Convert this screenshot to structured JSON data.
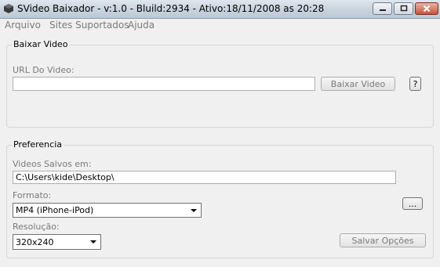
{
  "window": {
    "title": "SVideo Baixador - v:1.0 - Bluild:2934  - Ativo:18/11/2008 as 20:28"
  },
  "menu": [
    "Arquivo",
    "Sites Suportados",
    "Ajuda"
  ],
  "baixar": {
    "group_title": "Baixar Video",
    "url_label": "URL Do Video:",
    "url_value": "",
    "download_button": "Baixar Video",
    "help_button": "?"
  },
  "preferencia": {
    "group_title": "Preferencia",
    "saved_label": "Videos Salvos em:",
    "saved_path": "C:\\Users\\kide\\Desktop\\",
    "browse_button": "...",
    "format_label": "Formato:",
    "format_value": "MP4 (iPhone-iPod)",
    "resolution_label": "Resolução:",
    "resolution_value": "320x240",
    "save_button": "Salvar Opções"
  }
}
